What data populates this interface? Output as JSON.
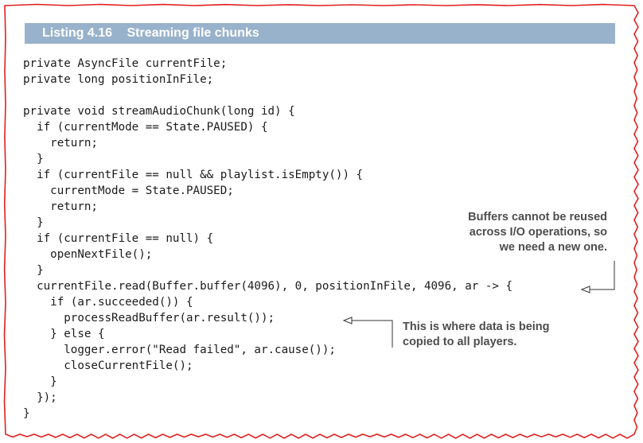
{
  "listing": {
    "number": "Listing 4.16",
    "title": "Streaming file chunks"
  },
  "code_lines": [
    "private AsyncFile currentFile;",
    "private long positionInFile;",
    "",
    "private void streamAudioChunk(long id) {",
    "  if (currentMode == State.PAUSED) {",
    "    return;",
    "  }",
    "  if (currentFile == null && playlist.isEmpty()) {",
    "    currentMode = State.PAUSED;",
    "    return;",
    "  }",
    "  if (currentFile == null) {",
    "    openNextFile();",
    "  }",
    "  currentFile.read(Buffer.buffer(4096), 0, positionInFile, 4096, ar -> {",
    "    if (ar.succeeded()) {",
    "      processReadBuffer(ar.result());",
    "    } else {",
    "      logger.error(\"Read failed\", ar.cause());",
    "      closeCurrentFile();",
    "    }",
    "  });",
    "}"
  ],
  "annotations": [
    {
      "lines": [
        "Buffers cannot be reused",
        "across I/O operations, so",
        "we need a new one."
      ]
    },
    {
      "lines": [
        "This is where data is being",
        "copied to all players."
      ]
    }
  ],
  "colors": {
    "border": "#e02020",
    "header_bar": "#98b2cc",
    "annotation_text": "#4d4d4d"
  }
}
